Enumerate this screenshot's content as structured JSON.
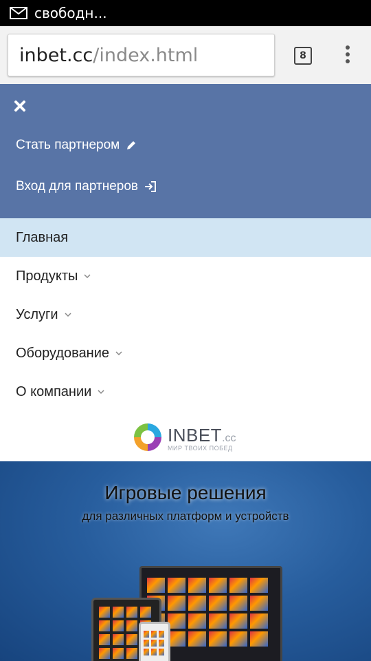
{
  "status_bar": {
    "notification_icon": "mail-icon",
    "text": "свободн..."
  },
  "browser": {
    "url_domain": "inbet.cc",
    "url_path": "/index.html",
    "tab_count": "8",
    "menu_icon": "more-vert-icon"
  },
  "partner_menu": {
    "close_icon": "close-icon",
    "become_partner": "Стать партнером",
    "partner_login": "Вход для партнеров"
  },
  "nav": {
    "items": [
      {
        "label": "Главная",
        "active": true,
        "has_dropdown": false
      },
      {
        "label": "Продукты",
        "active": false,
        "has_dropdown": true
      },
      {
        "label": "Услуги",
        "active": false,
        "has_dropdown": true
      },
      {
        "label": "Оборудование",
        "active": false,
        "has_dropdown": true
      },
      {
        "label": "О компании",
        "active": false,
        "has_dropdown": true
      }
    ]
  },
  "logo": {
    "name": "INBET",
    "suffix": ".cc",
    "slogan": "МИР ТВОИХ ПОБЕД"
  },
  "hero": {
    "title": "Игровые решения",
    "subtitle": "для различных платформ и устройств"
  },
  "colors": {
    "partner_bg": "#5874a6",
    "active_nav_bg": "#d1e5f3",
    "hero_bg": "#275d9d"
  }
}
